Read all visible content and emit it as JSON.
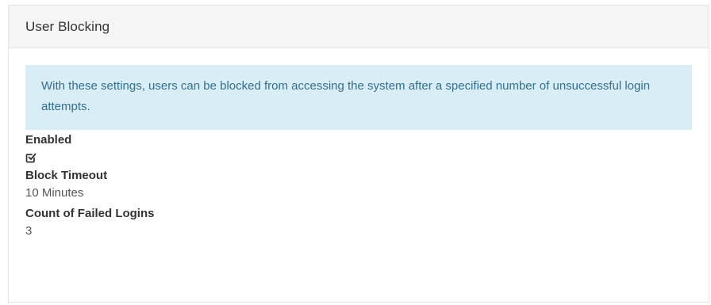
{
  "panel": {
    "title": "User Blocking"
  },
  "info": {
    "text": "With these settings, users can be blocked from accessing the system after a specified number of unsuccessful login attempts."
  },
  "fields": {
    "enabled": {
      "label": "Enabled",
      "value_icon": "checked-checkbox-icon",
      "checked": true
    },
    "block_timeout": {
      "label": "Block Timeout",
      "value": "10 Minutes"
    },
    "failed_logins": {
      "label": "Count of Failed Logins",
      "value": "3"
    }
  },
  "colors": {
    "info_background": "#d9edf7",
    "info_text": "#31708f",
    "header_background": "#f5f5f5"
  }
}
